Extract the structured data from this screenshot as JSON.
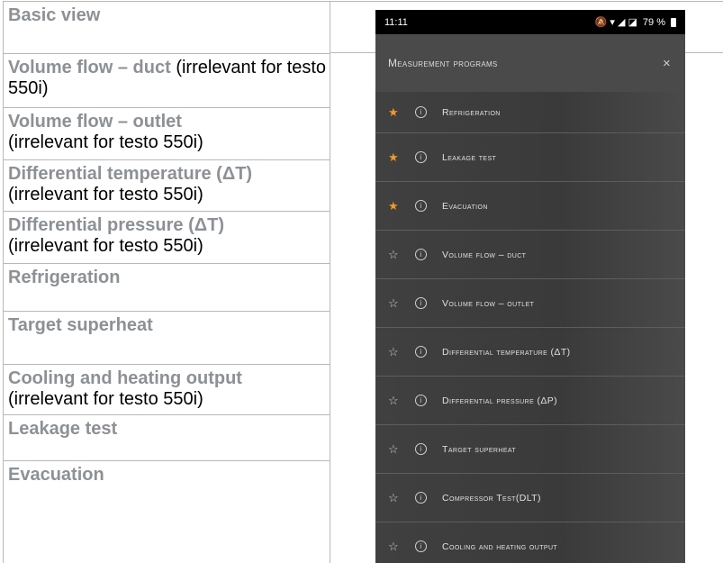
{
  "table": {
    "rows": [
      {
        "title": "Basic view",
        "note": ""
      },
      {
        "title": "Volume flow – duct",
        "note": " (irrelevant for testo 550i)"
      },
      {
        "title": "Volume flow – outlet",
        "note": "(irrelevant for testo 550i)"
      },
      {
        "title": "Differential temperature (ΔT)",
        "note": "(irrelevant for testo 550i)"
      },
      {
        "title": "Differential pressure (ΔT)",
        "note": "(irrelevant for testo 550i)"
      },
      {
        "title": "Refrigeration",
        "note": ""
      },
      {
        "title": "Target superheat",
        "note": ""
      },
      {
        "title": "Cooling and heating output",
        "note": "(irrelevant for testo 550i)"
      },
      {
        "title": "Leakage test",
        "note": ""
      },
      {
        "title": "Evacuation",
        "note": ""
      }
    ]
  },
  "phone": {
    "status": {
      "time": "11:11",
      "icons": "🔕 ▾ ◢ ◪",
      "battery": "79 %"
    },
    "header": {
      "title": "Measurement programs",
      "close": "×"
    },
    "programs": [
      {
        "label": "Refrigeration",
        "favorite": true
      },
      {
        "label": "Leakage test",
        "favorite": true
      },
      {
        "label": "Evacuation",
        "favorite": true
      },
      {
        "label": "Volume flow – duct",
        "favorite": false
      },
      {
        "label": "Volume flow – outlet",
        "favorite": false
      },
      {
        "label": "Differential temperature (ΔT)",
        "favorite": false
      },
      {
        "label": "Differential pressure (ΔP)",
        "favorite": false
      },
      {
        "label": "Target superheat",
        "favorite": false
      },
      {
        "label": "Compressor Test(DLT)",
        "favorite": false
      },
      {
        "label": "Cooling and heating output",
        "favorite": false
      }
    ],
    "star_filled": "★",
    "star_empty": "☆",
    "info_glyph": "i",
    "colors": {
      "favorite_star": "#f29a21",
      "list_bg": "#3d3d3d",
      "header_bg": "#4a4a4a"
    }
  }
}
